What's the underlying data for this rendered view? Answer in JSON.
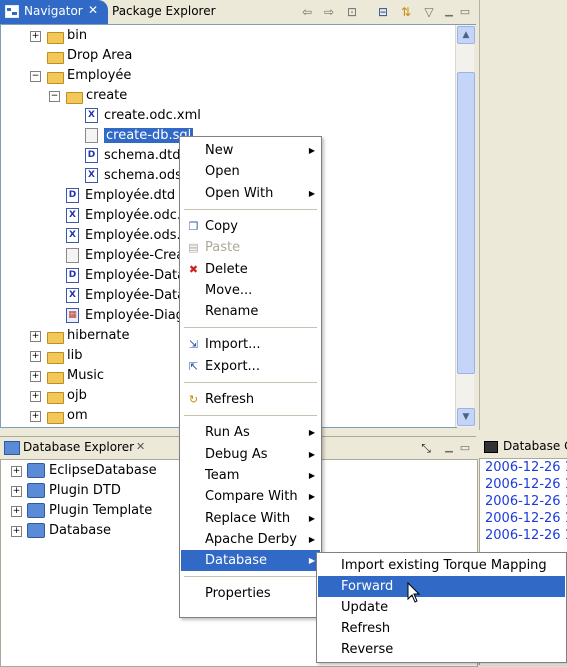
{
  "navigator": {
    "tab_label": "Navigator",
    "tab_close": "✕",
    "other_tab": "Package Explorer",
    "tree": [
      {
        "label": "bin",
        "kind": "folder",
        "level": 0,
        "expander": "+"
      },
      {
        "label": "Drop Area",
        "kind": "folder",
        "level": 0,
        "expander": ""
      },
      {
        "label": "Employée",
        "kind": "folder",
        "level": 0,
        "expander": "−"
      },
      {
        "label": "create",
        "kind": "folder",
        "level": 1,
        "expander": "−"
      },
      {
        "label": "create.odc.xml",
        "kind": "x",
        "level": 2,
        "expander": ""
      },
      {
        "label": "create-db.sql",
        "kind": "sql",
        "level": 2,
        "expander": "",
        "selected": true
      },
      {
        "label": "schema.dtd",
        "kind": "d",
        "level": 2,
        "expander": ""
      },
      {
        "label": "schema.ods.",
        "kind": "x",
        "level": 2,
        "expander": ""
      },
      {
        "label": "Employée.dtd",
        "kind": "d",
        "level": 1,
        "expander": ""
      },
      {
        "label": "Employée.odc.x",
        "kind": "x",
        "level": 1,
        "expander": ""
      },
      {
        "label": "Employée.ods.x",
        "kind": "x",
        "level": 1,
        "expander": ""
      },
      {
        "label": "Employée-Creat",
        "kind": "sql",
        "level": 1,
        "expander": ""
      },
      {
        "label": "Employée-Data",
        "kind": "d",
        "level": 1,
        "expander": ""
      },
      {
        "label": "Employée-Data",
        "kind": "x",
        "level": 1,
        "expander": ""
      },
      {
        "label": "Employée-Diagr",
        "kind": "diagram",
        "level": 1,
        "expander": ""
      },
      {
        "label": "hibernate",
        "kind": "folder",
        "level": 0,
        "expander": "+"
      },
      {
        "label": "lib",
        "kind": "folder",
        "level": 0,
        "expander": "+"
      },
      {
        "label": "Music",
        "kind": "folder",
        "level": 0,
        "expander": "+"
      },
      {
        "label": "ojb",
        "kind": "folder",
        "level": 0,
        "expander": "+"
      },
      {
        "label": "om",
        "kind": "folder",
        "level": 0,
        "expander": "+"
      }
    ]
  },
  "db_explorer": {
    "tab_label": "Database Explorer",
    "tab_close": "✕",
    "items": [
      "EclipseDatabase",
      "Plugin DTD",
      "Plugin Template",
      "Database"
    ]
  },
  "console": {
    "tab_label": "Database C",
    "lines": [
      "2006-12-26 1",
      "2006-12-26 1",
      "2006-12-26 1",
      "2006-12-26 1",
      "2006-12-26 1"
    ]
  },
  "context_menu": {
    "items": [
      {
        "label": "New",
        "submenu": true
      },
      {
        "label": "Open"
      },
      {
        "label": "Open With",
        "submenu": true
      },
      {
        "separator": true
      },
      {
        "label": "Copy",
        "icon": "copy-icon"
      },
      {
        "label": "Paste",
        "icon": "paste-icon",
        "disabled": true
      },
      {
        "label": "Delete",
        "icon": "delete-icon"
      },
      {
        "label": "Move..."
      },
      {
        "label": "Rename"
      },
      {
        "separator": true
      },
      {
        "label": "Import...",
        "icon": "import-icon"
      },
      {
        "label": "Export...",
        "icon": "export-icon"
      },
      {
        "separator": true
      },
      {
        "label": "Refresh",
        "icon": "refresh-icon"
      },
      {
        "separator": true
      },
      {
        "label": "Run As",
        "submenu": true
      },
      {
        "label": "Debug As",
        "submenu": true
      },
      {
        "label": "Team",
        "submenu": true
      },
      {
        "label": "Compare With",
        "submenu": true
      },
      {
        "label": "Replace With",
        "submenu": true
      },
      {
        "label": "Apache Derby",
        "submenu": true
      },
      {
        "label": "Database",
        "submenu": true,
        "highlighted": true
      },
      {
        "separator": true
      },
      {
        "label": "Properties"
      }
    ]
  },
  "database_submenu": {
    "items": [
      {
        "label": "Import existing Torque Mapping"
      },
      {
        "label": "Forward",
        "highlighted": true
      },
      {
        "label": "Update"
      },
      {
        "label": "Refresh"
      },
      {
        "label": "Reverse"
      }
    ]
  },
  "colors": {
    "selection": "#3169c6",
    "console_text": "#1c3bdb",
    "delete_red": "#d12020"
  }
}
